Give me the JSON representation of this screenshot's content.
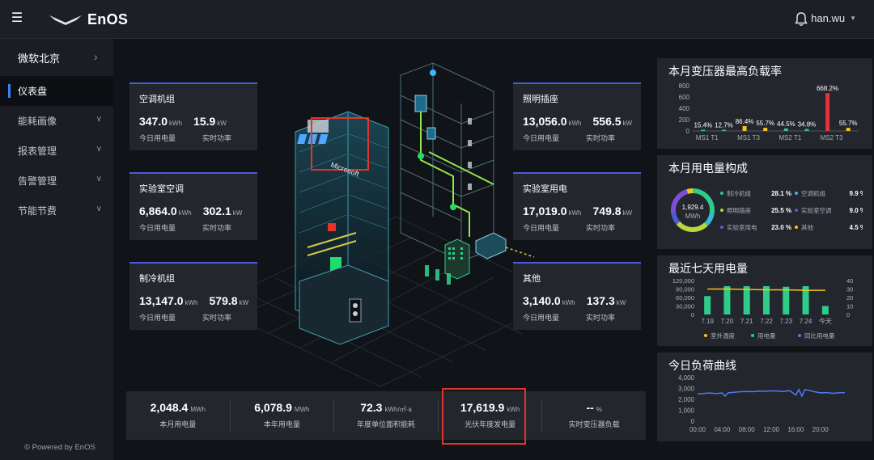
{
  "topbar": {
    "logo_text": "EnOS",
    "user_name": "han.wu"
  },
  "sidebar": {
    "site_name": "微软北京",
    "items": [
      {
        "label": "仪表盘",
        "active": true
      },
      {
        "label": "能耗画像",
        "active": false
      },
      {
        "label": "报表管理",
        "active": false
      },
      {
        "label": "告警管理",
        "active": false
      },
      {
        "label": "节能节费",
        "active": false
      }
    ],
    "footer": "© Powered by EnOS"
  },
  "scene": {
    "building_sign": "Microsoft"
  },
  "metrics": [
    {
      "title": "空调机组",
      "energy": "347.0",
      "energy_unit": "kWh",
      "power": "15.9",
      "power_unit": "kW",
      "energy_label": "今日用电量",
      "power_label": "实时功率"
    },
    {
      "title": "照明插座",
      "energy": "13,056.0",
      "energy_unit": "kWh",
      "power": "556.5",
      "power_unit": "kW",
      "energy_label": "今日用电量",
      "power_label": "实时功率"
    },
    {
      "title": "实验室空调",
      "energy": "6,864.0",
      "energy_unit": "kWh",
      "power": "302.1",
      "power_unit": "kW",
      "energy_label": "今日用电量",
      "power_label": "实时功率"
    },
    {
      "title": "实验室用电",
      "energy": "17,019.0",
      "energy_unit": "kWh",
      "power": "749.8",
      "power_unit": "kW",
      "energy_label": "今日用电量",
      "power_label": "实时功率"
    },
    {
      "title": "制冷机组",
      "energy": "13,147.0",
      "energy_unit": "kWh",
      "power": "579.8",
      "power_unit": "kW",
      "energy_label": "今日用电量",
      "power_label": "实时功率"
    },
    {
      "title": "其他",
      "energy": "3,140.0",
      "energy_unit": "kWh",
      "power": "137.3",
      "power_unit": "kW",
      "energy_label": "今日用电量",
      "power_label": "实时功率"
    }
  ],
  "summary": [
    {
      "value": "2,048.4",
      "unit": "MWh",
      "label": "本月用电量"
    },
    {
      "value": "6,078.9",
      "unit": "MWh",
      "label": "本年用电量"
    },
    {
      "value": "72.3",
      "unit": "kWh/㎡·a",
      "label": "年度单位面积能耗"
    },
    {
      "value": "17,619.9",
      "unit": "kWh",
      "label": "光伏年度发电量"
    },
    {
      "value": "--",
      "unit": "%",
      "label": "实时变压器负载"
    }
  ],
  "chart_data": [
    {
      "type": "bar",
      "title": "本月变压器最高负载率",
      "categories": [
        "MS1 T1",
        "",
        "MS1 T3",
        "",
        "MS2 T1",
        "",
        "MS2 T3",
        ""
      ],
      "x_tick_labels": [
        "MS1 T1",
        "MS1 T3",
        "MS2 T1",
        "MS2 T3"
      ],
      "values": [
        15.4,
        12.7,
        86.4,
        55.7,
        44.5,
        34.8,
        668.2,
        55.7
      ],
      "data_labels": [
        "15.4%",
        "12.7%",
        "86.4%",
        "55.7%",
        "44.5%",
        "34.8%",
        "668.2%",
        "55.7%"
      ],
      "colors": [
        "#2ecc8a",
        "#2ecc8a",
        "#f5c518",
        "#f5c518",
        "#2ecc8a",
        "#2ecc8a",
        "#e5323f",
        "#f5c518"
      ],
      "y_ticks": [
        "800",
        "600",
        "400",
        "200",
        "0"
      ],
      "ylim": [
        0,
        800
      ]
    },
    {
      "type": "pie",
      "title": "本月用电量构成",
      "center_value": "1,929.4",
      "center_unit": "MWh",
      "slices": [
        {
          "name": "制冷机组",
          "value": 28.1,
          "label": "28.1 %",
          "color": "#2ecc8a"
        },
        {
          "name": "空调机组",
          "value": 9.9,
          "label": "9.9 %",
          "color": "#3ab8d8"
        },
        {
          "name": "照明插座",
          "value": 25.5,
          "label": "25.5 %",
          "color": "#b7d83a"
        },
        {
          "name": "实验室空调",
          "value": 9.0,
          "label": "9.0 %",
          "color": "#4a5bd8"
        },
        {
          "name": "实验室用电",
          "value": 23.0,
          "label": "23.0 %",
          "color": "#7b4fd8"
        },
        {
          "name": "其他",
          "value": 4.5,
          "label": "4.5 %",
          "color": "#f5c518"
        }
      ]
    },
    {
      "type": "bar",
      "title": "最近七天用电量",
      "categories": [
        "7.19",
        "7.20",
        "7.21",
        "7.22",
        "7.23",
        "7.24",
        "今天"
      ],
      "series": [
        {
          "name": "用电量",
          "values": [
            65000,
            100000,
            100000,
            100000,
            98000,
            100000,
            30000
          ],
          "color": "#2ecc8a"
        },
        {
          "name": "同比用电量",
          "values": [],
          "color": "#4a7bf5"
        },
        {
          "name": "室外温度",
          "values": [
            30,
            30,
            29.5,
            29,
            29,
            28.5,
            28.5
          ],
          "color": "#f5c518",
          "kind": "line",
          "axis": "right"
        }
      ],
      "y_ticks": [
        "120,000",
        "90,000",
        "60,000",
        "30,000",
        "0"
      ],
      "ylim": [
        0,
        120000
      ],
      "y2_ticks": [
        "40",
        "30",
        "20",
        "10",
        "0"
      ],
      "y2lim": [
        0,
        40
      ],
      "legend": "bottom"
    },
    {
      "type": "line",
      "title": "今日负荷曲线",
      "x_ticks": [
        "00:00",
        "04:00",
        "08:00",
        "12:00",
        "16:00",
        "20:00"
      ],
      "y_ticks": [
        "4,000",
        "3,000",
        "2,000",
        "1,000",
        "0"
      ],
      "ylim": [
        0,
        4000
      ],
      "xlim": [
        0,
        24
      ],
      "series": [
        {
          "name": "",
          "color": "#4a7bf5",
          "x": [
            0,
            1,
            2,
            3,
            4,
            4.5,
            5,
            6,
            7,
            8,
            9,
            10,
            11,
            12,
            13,
            14,
            15,
            16,
            16.5,
            17,
            17.5,
            18,
            19,
            20,
            21,
            22,
            23,
            24
          ],
          "y": [
            2500,
            2550,
            2580,
            2540,
            2580,
            2300,
            2600,
            2650,
            2700,
            2720,
            2700,
            2760,
            2740,
            2780,
            2760,
            2720,
            2800,
            2400,
            2900,
            2300,
            2900,
            2850,
            2700,
            2600,
            2620,
            2560,
            2600,
            2620
          ]
        }
      ]
    }
  ]
}
